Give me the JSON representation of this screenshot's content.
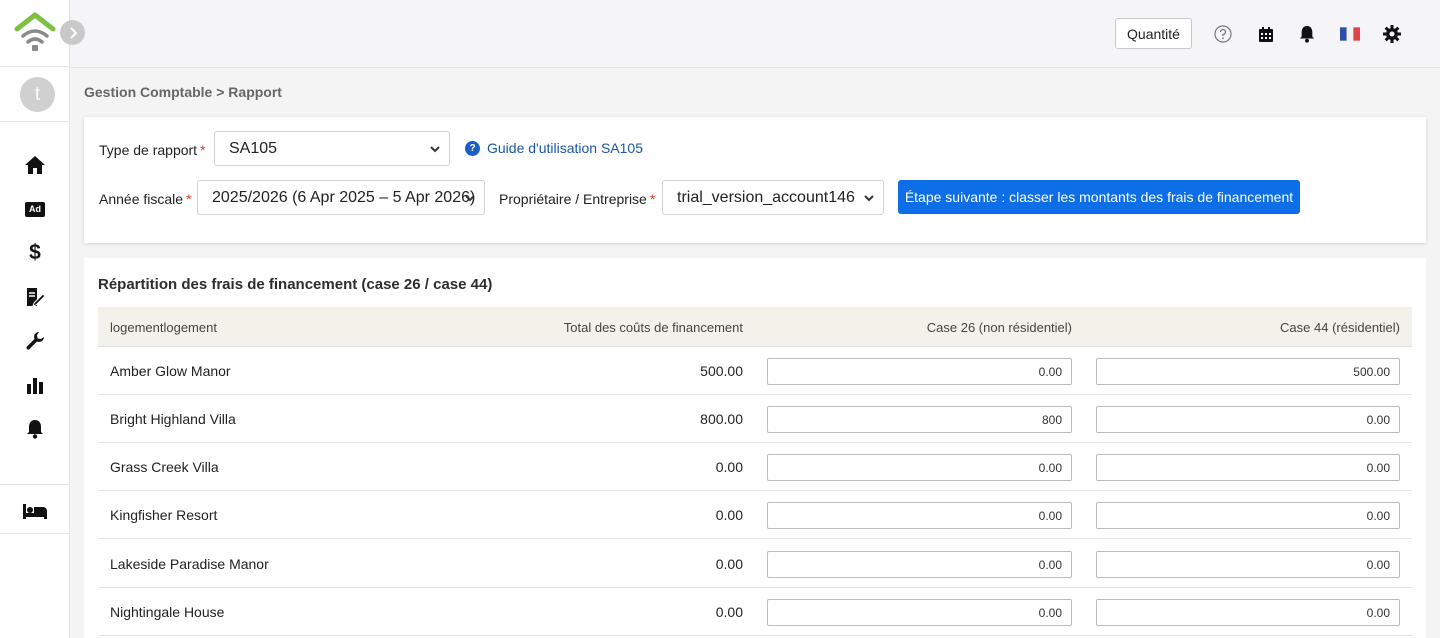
{
  "topbar": {
    "quantity_label": "Quantité"
  },
  "sidebar": {
    "avatar_letter": "t",
    "nav": [
      "home-icon",
      "ad-icon",
      "dollar-icon",
      "document-edit-icon",
      "wrench-icon",
      "bar-chart-icon",
      "bell-icon",
      "bed-icon"
    ],
    "ad_text": "Ad"
  },
  "colors": {
    "logo_green": "#7cc142",
    "logo_gray": "#8a8a8a",
    "primary_button": "#0d6ee8",
    "required": "#e53935",
    "header_row": "#f2f2ea"
  },
  "breadcrumb": "Gestion Comptable > Rapport",
  "filters": {
    "report_type_label": "Type de rapport",
    "report_type_value": "SA105",
    "guide_label": "Guide d'utilisation SA105",
    "fiscal_year_label": "Année fiscale",
    "fiscal_year_value": "2025/2026 (6 Apr 2025 – 5 Apr 2026)",
    "owner_label": "Propriétaire / Entreprise",
    "owner_value": "trial_version_account146",
    "required_mark": "*",
    "next_step_label": "Étape suivante : classer les montants des frais de financement"
  },
  "table": {
    "title": "Répartition des frais de financement (case 26 / case 44)",
    "headers": {
      "property": "logementlogement",
      "total": "Total des coûts de financement",
      "box26": "Case 26 (non résidentiel)",
      "box44": "Case 44 (résidentiel)"
    },
    "rows": [
      {
        "name": "Amber Glow Manor",
        "total": "500.00",
        "box26": "0.00",
        "box44": "500.00"
      },
      {
        "name": "Bright Highland Villa",
        "total": "800.00",
        "box26": "800",
        "box44": "0.00"
      },
      {
        "name": "Grass Creek Villa",
        "total": "0.00",
        "box26": "0.00",
        "box44": "0.00"
      },
      {
        "name": "Kingfisher Resort",
        "total": "0.00",
        "box26": "0.00",
        "box44": "0.00"
      },
      {
        "name": "Lakeside Paradise Manor",
        "total": "0.00",
        "box26": "0.00",
        "box44": "0.00"
      },
      {
        "name": "Nightingale House",
        "total": "0.00",
        "box26": "0.00",
        "box44": "0.00"
      }
    ]
  }
}
